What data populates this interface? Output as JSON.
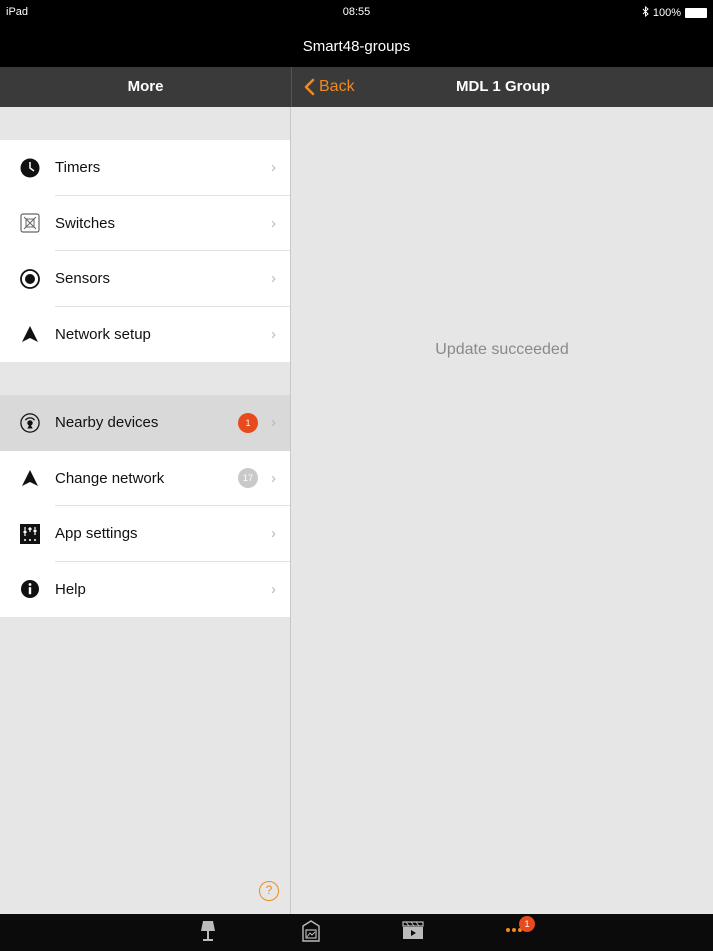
{
  "status_bar": {
    "device": "iPad",
    "time": "08:55",
    "battery": "100%"
  },
  "app_title": "Smart48-groups",
  "left_nav": {
    "title": "More"
  },
  "right_nav": {
    "back_label": "Back",
    "title": "MDL 1 Group"
  },
  "menu_group_1": [
    {
      "label": "Timers",
      "icon": "clock-icon"
    },
    {
      "label": "Switches",
      "icon": "switch-icon"
    },
    {
      "label": "Sensors",
      "icon": "sensor-icon"
    },
    {
      "label": "Network setup",
      "icon": "network-setup-icon"
    }
  ],
  "menu_group_2": [
    {
      "label": "Nearby devices",
      "icon": "nearby-devices-icon",
      "badge": "1",
      "selected": true
    },
    {
      "label": "Change network",
      "icon": "change-network-icon",
      "badge": "17"
    },
    {
      "label": "App settings",
      "icon": "app-settings-icon"
    },
    {
      "label": "Help",
      "icon": "info-icon"
    }
  ],
  "help_symbol": "?",
  "right_panel": {
    "message": "Update succeeded"
  },
  "tab_bar": {
    "tabs": [
      {
        "icon": "lamp-icon"
      },
      {
        "icon": "gallery-icon"
      },
      {
        "icon": "scenes-icon"
      },
      {
        "icon": "more-icon",
        "badge": "1"
      }
    ]
  },
  "colors": {
    "accent": "#f08a1c",
    "badge_red": "#e8491d",
    "nav_bg": "#3a3a3a",
    "panel_bg": "#e6e6e6"
  }
}
